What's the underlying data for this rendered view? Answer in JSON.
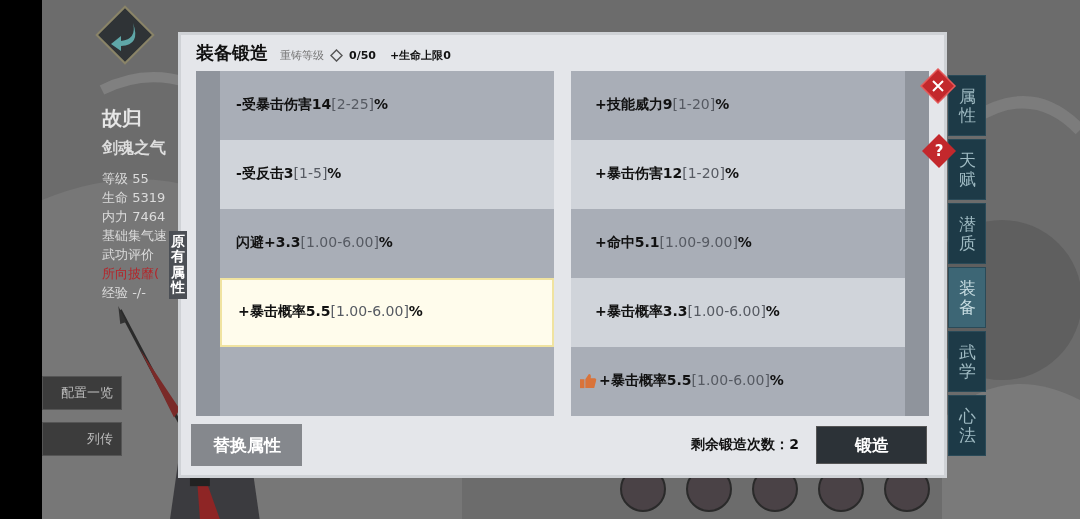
{
  "character": {
    "name": "故归",
    "title": "剑魂之气",
    "stats": [
      {
        "text": "等级 55",
        "color": "#dcdcdc"
      },
      {
        "text": "生命 5319",
        "color": "#dcdcdc"
      },
      {
        "text": "内力 7464",
        "color": "#dcdcdc"
      },
      {
        "text": "基础集气速",
        "color": "#dcdcdc"
      },
      {
        "text": "武功评价",
        "color": "#dcdcdc"
      },
      {
        "text": "所向披靡(",
        "color": "#b3262b"
      },
      {
        "text": "经验 -/-",
        "color": "#dcdcdc"
      }
    ]
  },
  "side_menu": [
    "配置一览",
    "列传"
  ],
  "dialog": {
    "title": "装备锻造",
    "reforge_label": "重铸等级",
    "reforge_value": "0/50",
    "bonus": "+生命上限0",
    "side_label": "原有属性",
    "original_attributes": [
      {
        "text": "-受暴击伤害14",
        "range": "[2-25]",
        "unit": "%",
        "selected": false
      },
      {
        "text": "-受反击3",
        "range": "[1-5]",
        "unit": "%",
        "selected": false
      },
      {
        "text": "闪避+3.3",
        "range": "[1.00-6.00]",
        "unit": "%",
        "selected": false
      },
      {
        "text": "+暴击概率5.5",
        "range": "[1.00-6.00]",
        "unit": "%",
        "selected": true
      },
      {
        "selected": false
      }
    ],
    "new_attributes": [
      {
        "text": "+技能威力9",
        "range": "[1-20]",
        "unit": "%",
        "recommended": false
      },
      {
        "text": "+暴击伤害12",
        "range": "[1-20]",
        "unit": "%",
        "recommended": false
      },
      {
        "text": "+命中5.1",
        "range": "[1.00-9.00]",
        "unit": "%",
        "recommended": false
      },
      {
        "text": "+暴击概率3.3",
        "range": "[1.00-6.00]",
        "unit": "%",
        "recommended": false
      },
      {
        "text": "+暴击概率5.5",
        "range": "[1.00-6.00]",
        "unit": "%",
        "recommended": true
      }
    ],
    "replace_button": "替换属性",
    "remaining": "剩余锻造次数：2",
    "forge_button": "锻造",
    "help": "?"
  },
  "tabs": [
    {
      "label": "属性",
      "selected": false
    },
    {
      "label": "天赋",
      "selected": false
    },
    {
      "label": "潜质",
      "selected": false
    },
    {
      "label": "装备",
      "selected": true
    },
    {
      "label": "武学",
      "selected": false
    },
    {
      "label": "心法",
      "selected": false
    }
  ]
}
